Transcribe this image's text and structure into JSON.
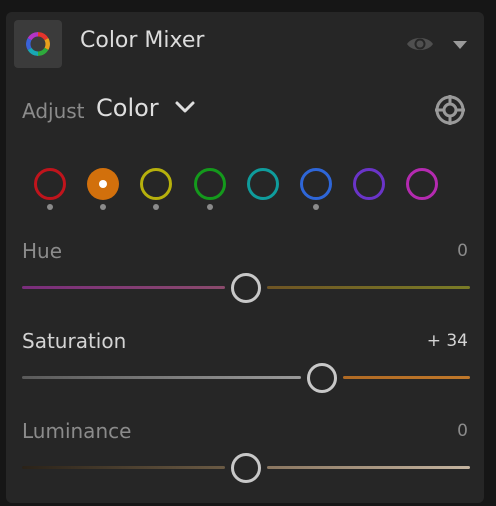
{
  "panel": {
    "title": "Color Mixer",
    "icons": {
      "panel": "color-wheel-icon",
      "visibility": "eye-icon",
      "collapse": "triangle-down-icon",
      "target": "targeted-adjustment-icon"
    }
  },
  "adjust": {
    "label": "Adjust",
    "selected": "Color",
    "chevron": "chevron-down-icon"
  },
  "colors": [
    {
      "name": "red",
      "color": "#c0141c",
      "has_edit": true,
      "selected": false
    },
    {
      "name": "orange",
      "color": "#d2700c",
      "has_edit": true,
      "selected": true
    },
    {
      "name": "yellow",
      "color": "#b6b00c",
      "has_edit": true,
      "selected": false
    },
    {
      "name": "green",
      "color": "#149a1c",
      "has_edit": true,
      "selected": false
    },
    {
      "name": "aqua",
      "color": "#0f9c9c",
      "has_edit": false,
      "selected": false
    },
    {
      "name": "blue",
      "color": "#2e66d8",
      "has_edit": true,
      "selected": false
    },
    {
      "name": "purple",
      "color": "#6a34c8",
      "has_edit": false,
      "selected": false
    },
    {
      "name": "magenta",
      "color": "#b42ab0",
      "has_edit": false,
      "selected": false
    }
  ],
  "sliders": {
    "hue": {
      "label": "Hue",
      "value_text": "0",
      "value": 0,
      "min": -100,
      "max": 100
    },
    "saturation": {
      "label": "Saturation",
      "value_text": "+ 34",
      "value": 34,
      "min": -100,
      "max": 100
    },
    "luminance": {
      "label": "Luminance",
      "value_text": "0",
      "value": 0,
      "min": -100,
      "max": 100
    }
  }
}
